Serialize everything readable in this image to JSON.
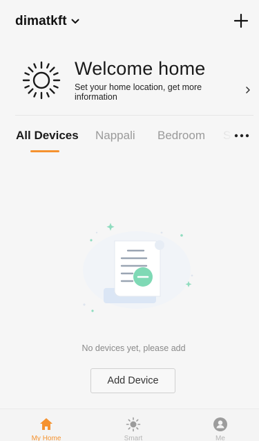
{
  "header": {
    "home_name": "dimatkft",
    "dropdown_icon": "chevron-down-icon",
    "add_icon": "plus-icon"
  },
  "welcome": {
    "title": "Welcome home",
    "subtitle": "Set your home location, get more information",
    "icon": "sun-icon",
    "arrow_icon": "chevron-right-icon"
  },
  "tabs": {
    "items": [
      {
        "label": "All Devices",
        "active": true
      },
      {
        "label": "Nappali",
        "active": false
      },
      {
        "label": "Bedroom",
        "active": false
      },
      {
        "label": "S",
        "active": false
      }
    ],
    "more_icon": "more-dots-icon"
  },
  "empty_state": {
    "illustration": "empty-document-illustration",
    "message": "No devices yet, please add",
    "button_label": "Add Device"
  },
  "bottom_nav": {
    "items": [
      {
        "label": "My Home",
        "icon": "home-icon",
        "active": true
      },
      {
        "label": "Smart",
        "icon": "smart-sun-icon",
        "active": false
      },
      {
        "label": "Me",
        "icon": "profile-icon",
        "active": false
      }
    ]
  },
  "colors": {
    "accent": "#f5922f",
    "background": "#f6f6f6",
    "illustration_mint": "#7fd9b5",
    "illustration_blue": "#e6eef8",
    "inactive_text": "#9a9a9a"
  }
}
